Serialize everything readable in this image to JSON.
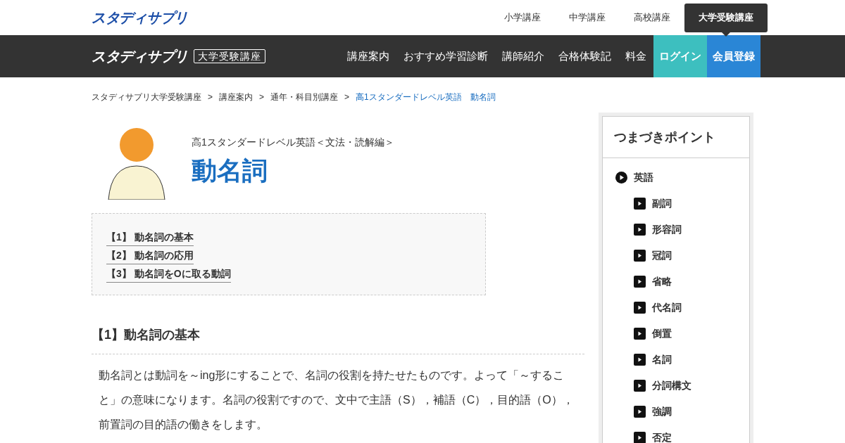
{
  "header": {
    "logo": "スタディサプリ",
    "tabs": [
      {
        "label": "小学講座",
        "selected": false
      },
      {
        "label": "中学講座",
        "selected": false
      },
      {
        "label": "高校講座",
        "selected": false
      },
      {
        "label": "大学受験講座",
        "selected": true
      }
    ]
  },
  "navbar": {
    "logo": "スタディサプリ",
    "logo_badge": "大学受験講座",
    "items": [
      {
        "label": "講座案内",
        "kind": "link"
      },
      {
        "label": "おすすめ学習診断",
        "kind": "link"
      },
      {
        "label": "講師紹介",
        "kind": "link"
      },
      {
        "label": "合格体験記",
        "kind": "link"
      },
      {
        "label": "料金",
        "kind": "link"
      },
      {
        "label": "ログイン",
        "kind": "login"
      },
      {
        "label": "会員登録",
        "kind": "register"
      }
    ]
  },
  "breadcrumb": [
    {
      "label": "スタディサプリ大学受験講座",
      "current": false
    },
    {
      "label": "講座案内",
      "current": false
    },
    {
      "label": "通年・科目別講座",
      "current": false
    },
    {
      "label": "高1スタンダードレベル英語　動名詞",
      "current": true
    }
  ],
  "breadcrumb_separator": ">",
  "page": {
    "subtitle": "高1スタンダードレベル英語＜文法・読解編＞",
    "title": "動名詞"
  },
  "toc": [
    "【1】 動名詞の基本",
    "【2】 動名詞の応用",
    "【3】 動名詞をOに取る動詞"
  ],
  "section": {
    "heading": "【1】動名詞の基本",
    "body": "動名詞とは動詞を～ing形にすることで、名詞の役割を持たせたものです。よって「～すること」の意味になります。名詞の役割ですので、文中で主語（S），補語（C），目的語（O），前置詞の目的語の働きをします。"
  },
  "sidebar": {
    "title": "つまづきポイント",
    "tree": [
      {
        "label": "英語",
        "children": [
          {
            "label": "副詞"
          },
          {
            "label": "形容詞"
          },
          {
            "label": "冠詞"
          },
          {
            "label": "省略"
          },
          {
            "label": "代名詞"
          },
          {
            "label": "倒置"
          },
          {
            "label": "名詞"
          },
          {
            "label": "分詞構文"
          },
          {
            "label": "強調"
          },
          {
            "label": "否定"
          }
        ]
      }
    ]
  }
}
